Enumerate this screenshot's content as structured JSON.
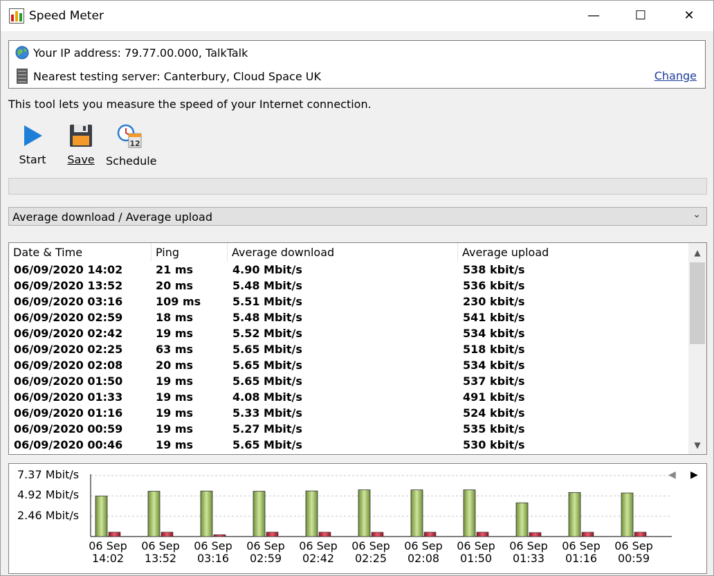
{
  "window": {
    "title": "Speed Meter",
    "minimize": "—",
    "maximize": "☐",
    "close": "✕"
  },
  "info": {
    "ip_text": "Your IP address: 79.77.00.000, TalkTalk",
    "server_text": "Nearest testing server: Canterbury, Cloud Space UK",
    "change_label": "Change"
  },
  "description": "This tool lets you measure the speed of your Internet connection.",
  "toolbar": {
    "start_label": "Start",
    "save_label": "Save",
    "schedule_label": "Schedule"
  },
  "view_select": {
    "value": "Average download / Average upload"
  },
  "table": {
    "columns": [
      "Date & Time",
      "Ping",
      "Average download",
      "Average upload"
    ],
    "rows": [
      [
        "06/09/2020 14:02",
        "21 ms",
        "4.90 Mbit/s",
        "538 kbit/s"
      ],
      [
        "06/09/2020 13:52",
        "20 ms",
        "5.48 Mbit/s",
        "536 kbit/s"
      ],
      [
        "06/09/2020 03:16",
        "109 ms",
        "5.51 Mbit/s",
        "230 kbit/s"
      ],
      [
        "06/09/2020 02:59",
        "18 ms",
        "5.48 Mbit/s",
        "541 kbit/s"
      ],
      [
        "06/09/2020 02:42",
        "19 ms",
        "5.52 Mbit/s",
        "534 kbit/s"
      ],
      [
        "06/09/2020 02:25",
        "63 ms",
        "5.65 Mbit/s",
        "518 kbit/s"
      ],
      [
        "06/09/2020 02:08",
        "20 ms",
        "5.65 Mbit/s",
        "534 kbit/s"
      ],
      [
        "06/09/2020 01:50",
        "19 ms",
        "5.65 Mbit/s",
        "537 kbit/s"
      ],
      [
        "06/09/2020 01:33",
        "19 ms",
        "4.08 Mbit/s",
        "491 kbit/s"
      ],
      [
        "06/09/2020 01:16",
        "19 ms",
        "5.33 Mbit/s",
        "524 kbit/s"
      ],
      [
        "06/09/2020 00:59",
        "19 ms",
        "5.27 Mbit/s",
        "535 kbit/s"
      ],
      [
        "06/09/2020 00:46",
        "19 ms",
        "5.65 Mbit/s",
        "530 kbit/s"
      ]
    ]
  },
  "chart_data": {
    "type": "bar",
    "ylim": [
      0,
      7.37
    ],
    "yticks": [
      "7.37 Mbit/s",
      "4.92 Mbit/s",
      "2.46 Mbit/s"
    ],
    "ytick_values": [
      7.37,
      4.92,
      2.46
    ],
    "categories": [
      [
        "06 Sep",
        "14:02"
      ],
      [
        "06 Sep",
        "13:52"
      ],
      [
        "06 Sep",
        "03:16"
      ],
      [
        "06 Sep",
        "02:59"
      ],
      [
        "06 Sep",
        "02:42"
      ],
      [
        "06 Sep",
        "02:25"
      ],
      [
        "06 Sep",
        "02:08"
      ],
      [
        "06 Sep",
        "01:50"
      ],
      [
        "06 Sep",
        "01:33"
      ],
      [
        "06 Sep",
        "01:16"
      ],
      [
        "06 Sep",
        "00:59"
      ]
    ],
    "series": [
      {
        "key": "download",
        "color": "#9bbf5a",
        "values": [
          4.9,
          5.48,
          5.51,
          5.48,
          5.52,
          5.65,
          5.65,
          5.65,
          4.08,
          5.33,
          5.27
        ]
      },
      {
        "key": "upload",
        "color": "#c0283a",
        "values": [
          0.538,
          0.536,
          0.23,
          0.541,
          0.534,
          0.518,
          0.534,
          0.537,
          0.491,
          0.524,
          0.535
        ]
      }
    ],
    "grid": true
  },
  "colors": {
    "link": "#1a3a9a",
    "play": "#1e7fd8",
    "download_bar": "#9bbf5a",
    "upload_bar": "#c0283a"
  }
}
